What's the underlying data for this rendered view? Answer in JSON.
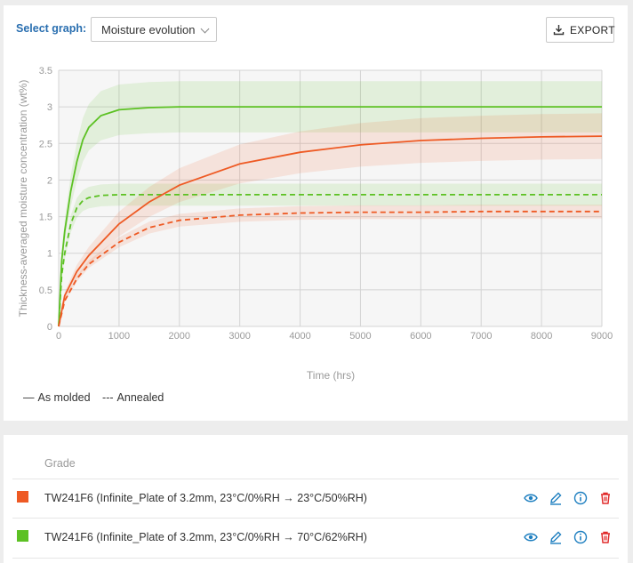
{
  "controls": {
    "select_label": "Select graph:",
    "select_value": "Moisture evolution",
    "export_label": "EXPORT"
  },
  "chart_data": {
    "type": "line",
    "title": "",
    "xlabel": "Time (hrs)",
    "ylabel": "Thickness-averaged moisture concentration (wt%)",
    "xlim": [
      0,
      9000
    ],
    "ylim": [
      0,
      3.5
    ],
    "x_ticks": [
      "0",
      "1000",
      "2000",
      "3000",
      "4000",
      "5000",
      "6000",
      "7000",
      "8000",
      "9000"
    ],
    "y_ticks": [
      "0",
      "0.5",
      "1",
      "1.5",
      "2",
      "2.5",
      "3",
      "3.5"
    ],
    "grid": true,
    "legend_entries": [
      {
        "symbol": "—",
        "label": "As molded"
      },
      {
        "symbol": "---",
        "label": "Annealed"
      }
    ],
    "series": [
      {
        "color": "#5cc123",
        "dash": "solid",
        "band": [
          2.65,
          3.35
        ],
        "x": [
          0,
          50,
          100,
          200,
          300,
          400,
          500,
          700,
          1000,
          1500,
          2000,
          9000
        ],
        "y": [
          0,
          0.9,
          1.3,
          1.85,
          2.25,
          2.55,
          2.72,
          2.88,
          2.96,
          2.99,
          3.0,
          3.0
        ]
      },
      {
        "color": "#5cc123",
        "dash": "dashed",
        "band": [
          1.65,
          1.95
        ],
        "x": [
          0,
          50,
          100,
          200,
          300,
          400,
          500,
          700,
          1000,
          9000
        ],
        "y": [
          0,
          0.7,
          1.0,
          1.4,
          1.62,
          1.72,
          1.76,
          1.79,
          1.8,
          1.8
        ]
      },
      {
        "color": "#ee5a24",
        "dash": "solid",
        "band_rel": 0.12,
        "x": [
          0,
          100,
          300,
          500,
          1000,
          1500,
          2000,
          3000,
          4000,
          5000,
          6000,
          7000,
          8000,
          9000
        ],
        "y": [
          0,
          0.42,
          0.75,
          0.97,
          1.4,
          1.7,
          1.93,
          2.22,
          2.38,
          2.48,
          2.54,
          2.57,
          2.59,
          2.6
        ]
      },
      {
        "color": "#ee5a24",
        "dash": "dashed",
        "band_rel": 0.06,
        "x": [
          0,
          100,
          300,
          500,
          1000,
          1500,
          2000,
          3000,
          4000,
          5000,
          6000,
          7000,
          8000,
          9000
        ],
        "y": [
          0,
          0.35,
          0.65,
          0.85,
          1.15,
          1.35,
          1.45,
          1.52,
          1.55,
          1.56,
          1.56,
          1.57,
          1.57,
          1.57
        ]
      }
    ]
  },
  "table": {
    "header": "Grade",
    "rows": [
      {
        "color": "#ee5a24",
        "label": "TW241F6 (Infinite_Plate of 3.2mm, 23°C/0%RH → 23°C/50%RH)"
      },
      {
        "color": "#5cc123",
        "label": "TW241F6 (Infinite_Plate of 3.2mm, 23°C/0%RH → 70°C/62%RH)"
      }
    ],
    "action_icons": [
      "eye-icon",
      "pencil-icon",
      "info-icon",
      "trash-icon"
    ]
  }
}
